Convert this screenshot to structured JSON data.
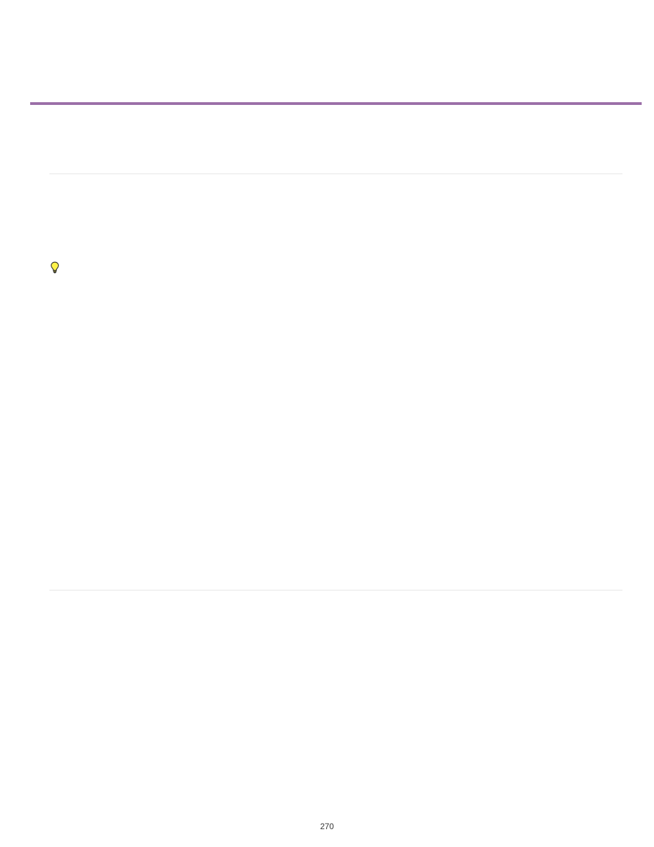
{
  "page_number": "270",
  "icons": {
    "bulb": "lightbulb-icon"
  },
  "divider_color": "#9b6fa8"
}
